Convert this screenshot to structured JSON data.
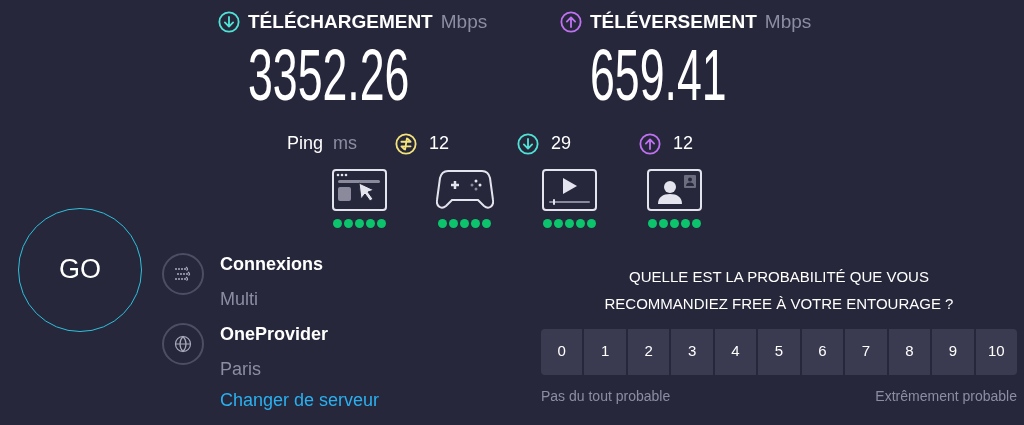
{
  "download": {
    "label": "TÉLÉCHARGEMENT",
    "unit": "Mbps",
    "value": "3352.26"
  },
  "upload": {
    "label": "TÉLÉVERSEMENT",
    "unit": "Mbps",
    "value": "659.41"
  },
  "ping": {
    "label": "Ping",
    "unit": "ms",
    "items": [
      {
        "kind": "idle",
        "value": "12"
      },
      {
        "kind": "download",
        "value": "29"
      },
      {
        "kind": "upload",
        "value": "12"
      }
    ]
  },
  "activities": [
    {
      "kind": "browsing",
      "stars": 5
    },
    {
      "kind": "gaming",
      "stars": 5
    },
    {
      "kind": "video",
      "stars": 5
    },
    {
      "kind": "videocall",
      "stars": 5
    }
  ],
  "go_button": "GO",
  "connections": {
    "label": "Connexions",
    "value": "Multi"
  },
  "server": {
    "label": "OneProvider",
    "location": "Paris",
    "link": "Changer de serveur"
  },
  "survey": {
    "question": "QUELLE EST LA PROBABILITÉ QUE VOUS RECOMMANDIEZ FREE À VOTRE ENTOURAGE ?",
    "options": [
      "0",
      "1",
      "2",
      "3",
      "4",
      "5",
      "6",
      "7",
      "8",
      "9",
      "10"
    ],
    "low_label": "Pas du tout probable",
    "high_label": "Extrêmement probable"
  }
}
